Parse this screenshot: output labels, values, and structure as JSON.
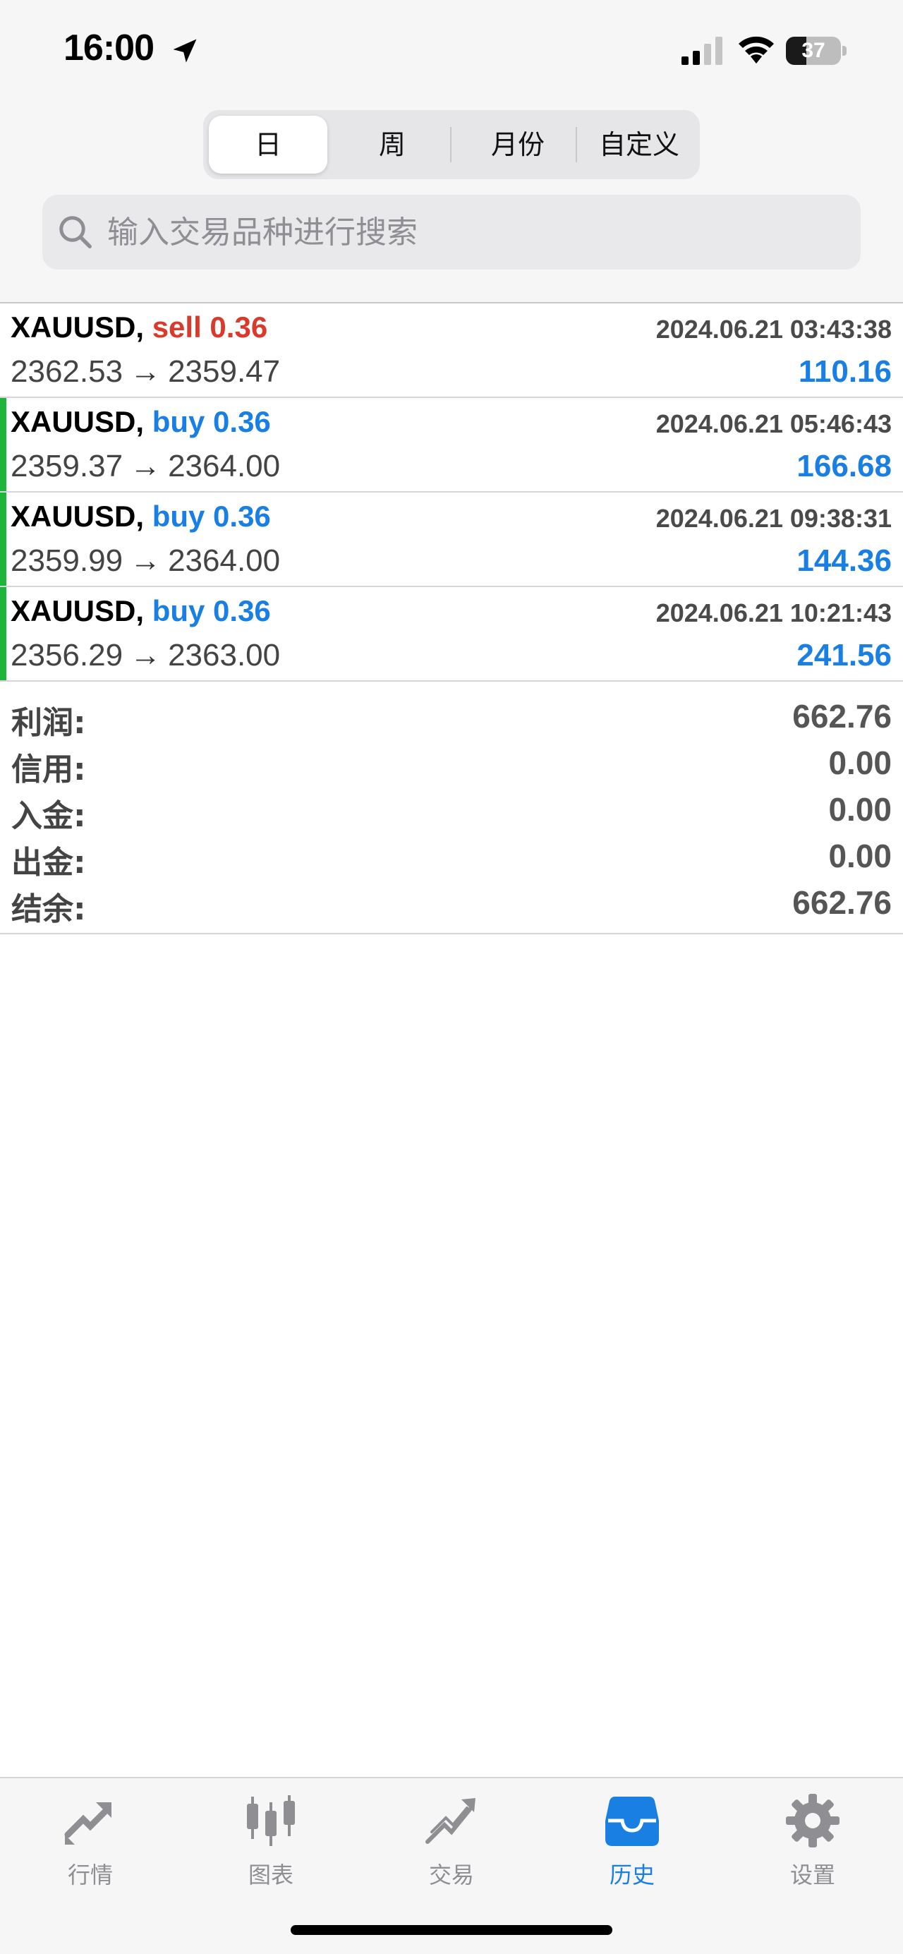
{
  "status_bar": {
    "time": "16:00",
    "battery_percent": 37,
    "battery_label": "37"
  },
  "period_tabs": [
    {
      "label": "日",
      "active": true
    },
    {
      "label": "周",
      "active": false
    },
    {
      "label": "月份",
      "active": false
    },
    {
      "label": "自定义",
      "active": false
    }
  ],
  "search": {
    "placeholder": "输入交易品种进行搜索"
  },
  "trades": [
    {
      "symbol": "XAUUSD,",
      "side": "sell 0.36",
      "time": "2024.06.21 03:43:38",
      "open": "2362.53",
      "close": "2359.47",
      "arrow": "→",
      "profit": "110.16",
      "accent": "#ffffff"
    },
    {
      "symbol": "XAUUSD,",
      "side": "buy 0.36",
      "time": "2024.06.21 05:46:43",
      "open": "2359.37",
      "close": "2364.00",
      "arrow": "→",
      "profit": "166.68",
      "accent": "#1fb53a"
    },
    {
      "symbol": "XAUUSD,",
      "side": "buy 0.36",
      "time": "2024.06.21 09:38:31",
      "open": "2359.99",
      "close": "2364.00",
      "arrow": "→",
      "profit": "144.36",
      "accent": "#1fb53a"
    },
    {
      "symbol": "XAUUSD,",
      "side": "buy 0.36",
      "time": "2024.06.21 10:21:43",
      "open": "2356.29",
      "close": "2363.00",
      "arrow": "→",
      "profit": "241.56",
      "accent": "#1fb53a"
    }
  ],
  "summary": [
    {
      "label": "利润:",
      "value": "662.76"
    },
    {
      "label": "信用:",
      "value": "0.00"
    },
    {
      "label": "入金:",
      "value": "0.00"
    },
    {
      "label": "出金:",
      "value": "0.00"
    },
    {
      "label": "结余:",
      "value": "662.76"
    }
  ],
  "tab_bar": [
    {
      "label": "行情",
      "icon": "quotes-icon",
      "active": false
    },
    {
      "label": "图表",
      "icon": "chart-icon",
      "active": false
    },
    {
      "label": "交易",
      "icon": "trade-icon",
      "active": false
    },
    {
      "label": "历史",
      "icon": "history-icon",
      "active": true
    },
    {
      "label": "设置",
      "icon": "settings-icon",
      "active": false
    }
  ],
  "colors": {
    "sell": "#d93a2b",
    "buy": "#1a7fe3",
    "profit": "#1a7fe3",
    "active_tab": "#1a7fe3",
    "inactive_tab": "#8e8e93"
  }
}
